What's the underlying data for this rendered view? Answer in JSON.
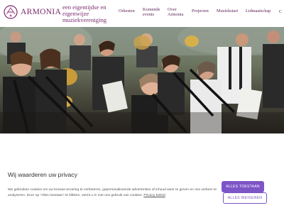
{
  "header": {
    "logo_text": "ARMONIA",
    "logo_icon": "armonia-logo-mark",
    "tagline": "een eigentijdse en eigenwijze muziekvereniging",
    "nav": [
      {
        "label": "Orkesten"
      },
      {
        "label": "Komende events"
      },
      {
        "label": "Over Armonia"
      },
      {
        "label": "Projecten"
      },
      {
        "label": "Muziekstart"
      },
      {
        "label": "Lidmaatschap"
      }
    ],
    "nav_extra": "C"
  },
  "hero": {
    "image": "orchestra-woodwind-section-photo"
  },
  "cookie": {
    "title": "Wij waarderen uw privacy",
    "text": "We gebruiken cookies om uw browse-ervaring te verbeteren, gepersonaliseerde advertenties of inhoud weer te geven en ons verkeer te analyseren. Door op \"Alles toestaan\" te klikken, stemt u in met ons gebruik van cookies.",
    "policy_link": "Privacy beleid",
    "accept_label": "ALLES TOESTAAN",
    "reject_label": "ALLES WEIGEREN"
  },
  "colors": {
    "brand": "#7a2a6e",
    "accent": "#7d55c7"
  }
}
